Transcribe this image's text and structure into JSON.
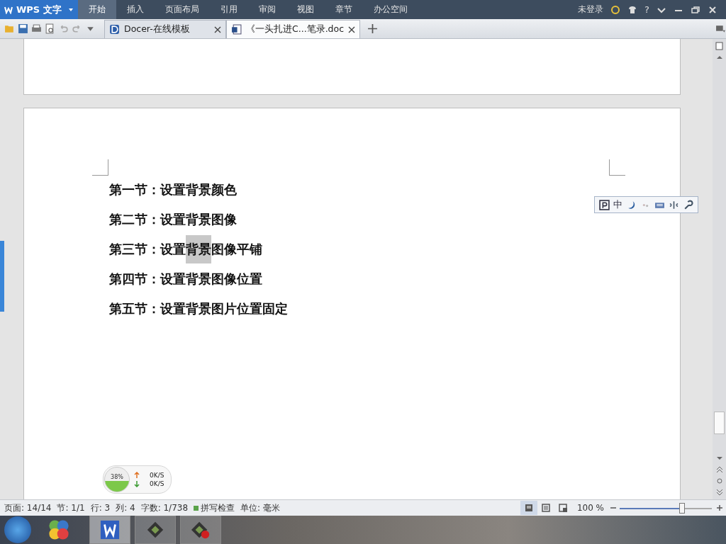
{
  "app_menu": {
    "label": "WPS 文字"
  },
  "menu_tabs": [
    {
      "label": "开始",
      "selected": true
    },
    {
      "label": "插入",
      "selected": false
    },
    {
      "label": "页面布局",
      "selected": false
    },
    {
      "label": "引用",
      "selected": false
    },
    {
      "label": "审阅",
      "selected": false
    },
    {
      "label": "视图",
      "selected": false
    },
    {
      "label": "章节",
      "selected": false
    },
    {
      "label": "办公空间",
      "selected": false
    }
  ],
  "login": "未登录",
  "help": "?",
  "doc_tabs": [
    {
      "label": "Docer-在线模板",
      "selected": false,
      "kind": "docer"
    },
    {
      "label": "《一头扎进C...笔录.doc",
      "selected": true,
      "kind": "doc"
    }
  ],
  "document": {
    "lines": [
      {
        "parts": [
          {
            "text": "第一节：设置背景颜色",
            "selected": false
          }
        ]
      },
      {
        "parts": [
          {
            "text": "第二节：设置背景图像",
            "selected": false
          }
        ]
      },
      {
        "parts": [
          {
            "text": "第三节：设置",
            "selected": false
          },
          {
            "text": "背景",
            "selected": true
          },
          {
            "text": "图像平铺",
            "selected": false
          }
        ]
      },
      {
        "parts": [
          {
            "text": "第四节：设置背景图像位置",
            "selected": false
          }
        ]
      },
      {
        "parts": [
          {
            "text": "第五节：设置背景图片位置固定",
            "selected": false
          }
        ]
      }
    ]
  },
  "ime_bar": {
    "mode": "中"
  },
  "net_widget": {
    "percent": "38%",
    "up": "0K/S",
    "down": "0K/S"
  },
  "status_bar": {
    "items": [
      "页面: 14/14",
      "节: 1/1",
      "行: 3",
      "列: 4",
      "字数: 1/738"
    ],
    "spell": "拼写检查",
    "unit": "单位: 毫米",
    "zoom": "100 %",
    "zoom_slider": {
      "level": 0.68
    }
  }
}
